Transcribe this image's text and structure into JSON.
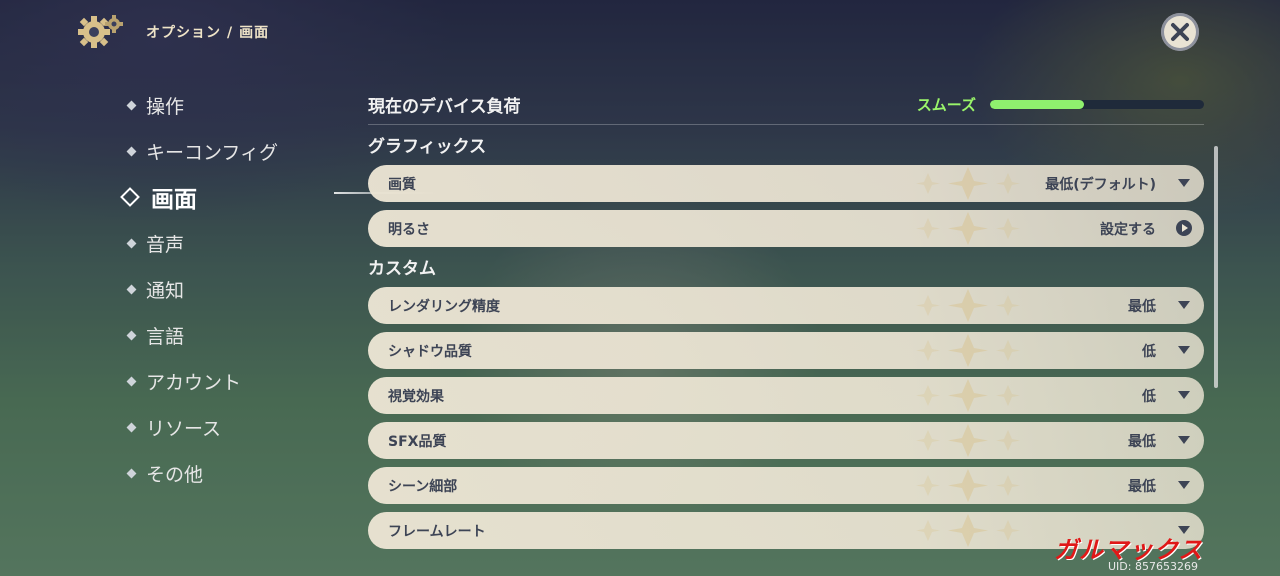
{
  "header": {
    "path_root": "オプション",
    "separator": "/",
    "path_current": "画面"
  },
  "sidebar": {
    "items": [
      {
        "label": "操作",
        "active": false
      },
      {
        "label": "キーコンフィグ",
        "active": false
      },
      {
        "label": "画面",
        "active": true
      },
      {
        "label": "音声",
        "active": false
      },
      {
        "label": "通知",
        "active": false
      },
      {
        "label": "言語",
        "active": false
      },
      {
        "label": "アカウント",
        "active": false
      },
      {
        "label": "リソース",
        "active": false
      },
      {
        "label": "その他",
        "active": false
      }
    ]
  },
  "device_load": {
    "title": "現在のデバイス負荷",
    "status": "スムーズ",
    "level_fraction": 0.44,
    "color": "#8ff06e"
  },
  "graphics": {
    "title": "グラフィックス",
    "rows": [
      {
        "label": "画質",
        "value": "最低(デフォルト)",
        "control": "dropdown"
      },
      {
        "label": "明るさ",
        "value": "設定する",
        "control": "arrow"
      }
    ]
  },
  "custom": {
    "title": "カスタム",
    "rows": [
      {
        "label": "レンダリング精度",
        "value": "最低",
        "control": "dropdown"
      },
      {
        "label": "シャドウ品質",
        "value": "低",
        "control": "dropdown"
      },
      {
        "label": "視覚効果",
        "value": "低",
        "control": "dropdown"
      },
      {
        "label": "SFX品質",
        "value": "最低",
        "control": "dropdown"
      },
      {
        "label": "シーン細部",
        "value": "最低",
        "control": "dropdown"
      },
      {
        "label": "フレームレート",
        "value": "",
        "control": "dropdown"
      }
    ]
  },
  "watermark": "ガルマックス",
  "uid": "UID: 857653269",
  "icons": {
    "settings": "gear-icon",
    "close": "close-icon",
    "dropdown": "chevron-down-icon",
    "arrow": "play-arrow-icon"
  }
}
